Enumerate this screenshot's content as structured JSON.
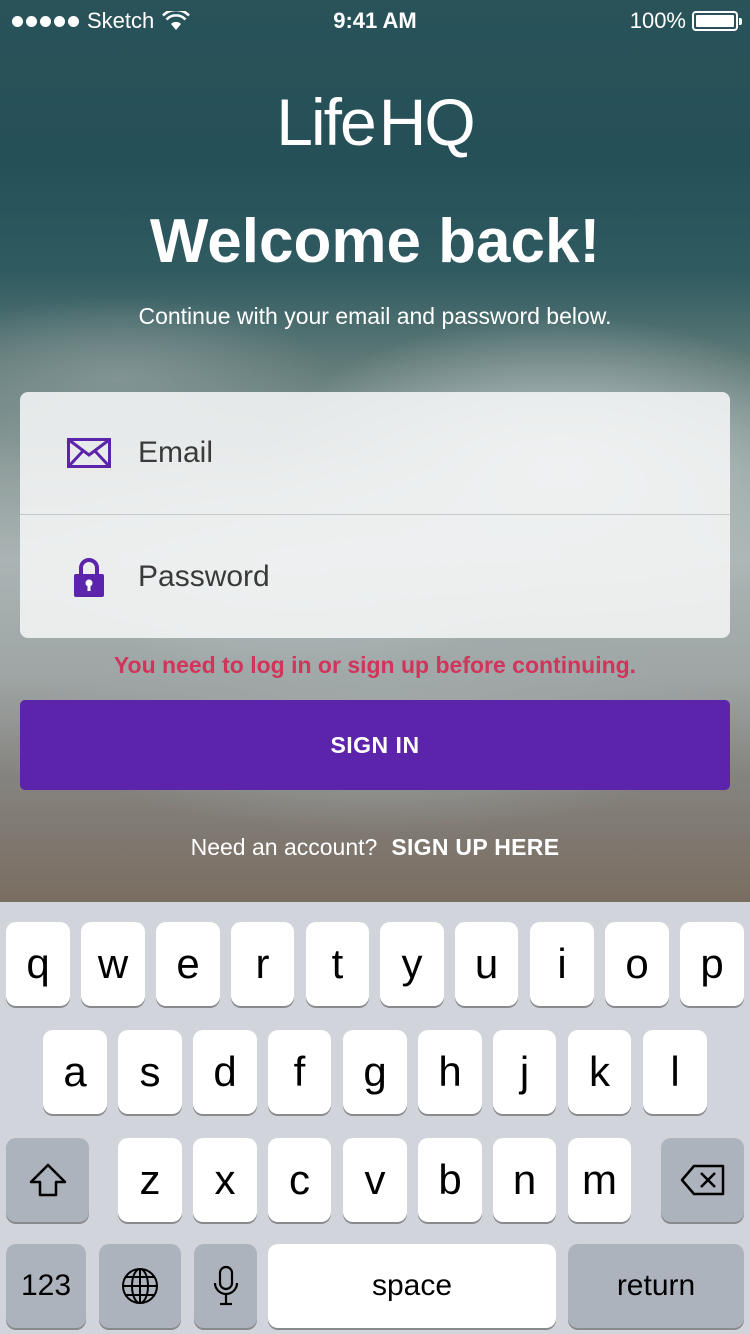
{
  "status_bar": {
    "carrier": "Sketch",
    "time": "9:41 AM",
    "battery": "100%",
    "battery_level": 1.0
  },
  "header": {
    "logo_life": "Life",
    "logo_hq": "HQ",
    "title": "Welcome back!",
    "subtitle": "Continue with your email and password below."
  },
  "form": {
    "email_placeholder": "Email",
    "password_placeholder": "Password",
    "error": "You need to log in or sign up before continuing.",
    "submit_label": "SIGN IN"
  },
  "signup": {
    "prompt": "Need an account?",
    "link": "SIGN UP HERE"
  },
  "colors": {
    "accent": "#5b24ab",
    "error": "#d2345c",
    "icon": "#5b24ab"
  },
  "keyboard": {
    "row1": [
      "q",
      "w",
      "e",
      "r",
      "t",
      "y",
      "u",
      "i",
      "o",
      "p"
    ],
    "row2": [
      "a",
      "s",
      "d",
      "f",
      "g",
      "h",
      "j",
      "k",
      "l"
    ],
    "row3": [
      "z",
      "x",
      "c",
      "v",
      "b",
      "n",
      "m"
    ],
    "numbers": "123",
    "space": "space",
    "return": "return",
    "icons": [
      "shift-icon",
      "backspace-icon",
      "globe-icon",
      "microphone-icon"
    ]
  }
}
